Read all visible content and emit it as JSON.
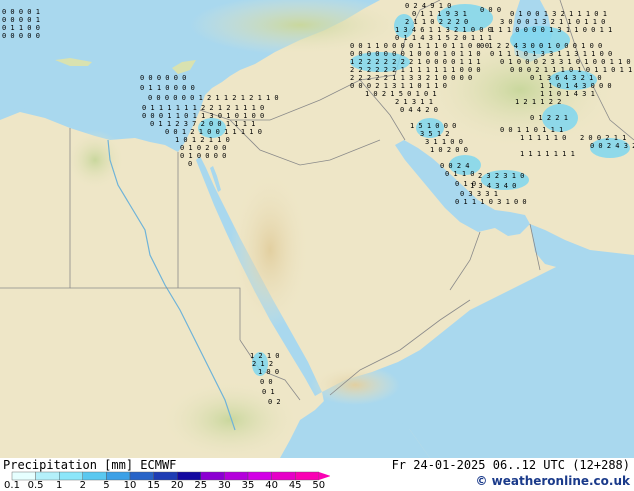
{
  "legend": {
    "title": "Precipitation [mm]",
    "model": "ECMWF",
    "ticks": [
      "0.1",
      "0.5",
      "1",
      "2",
      "5",
      "10",
      "15",
      "20",
      "25",
      "30",
      "35",
      "40",
      "45",
      "50"
    ],
    "colors": [
      "#e6ffff",
      "#b4f0fa",
      "#8ce6fa",
      "#5ac8f0",
      "#3ca0e6",
      "#2864c8",
      "#1e3cb4",
      "#140aa0",
      "#8c00d2",
      "#b400dc",
      "#d200e6",
      "#e600c8",
      "#fa00b4"
    ]
  },
  "run": {
    "label": "Fr 24-01-2025 06..12 UTC (12+288)"
  },
  "credit": "© weatheronline.co.uk",
  "map": {
    "sea_color": "#a9d8ee",
    "land_color": "#eee6c7",
    "precip_color": "#7fd7f0",
    "border_color": "#8a8a8a"
  }
}
